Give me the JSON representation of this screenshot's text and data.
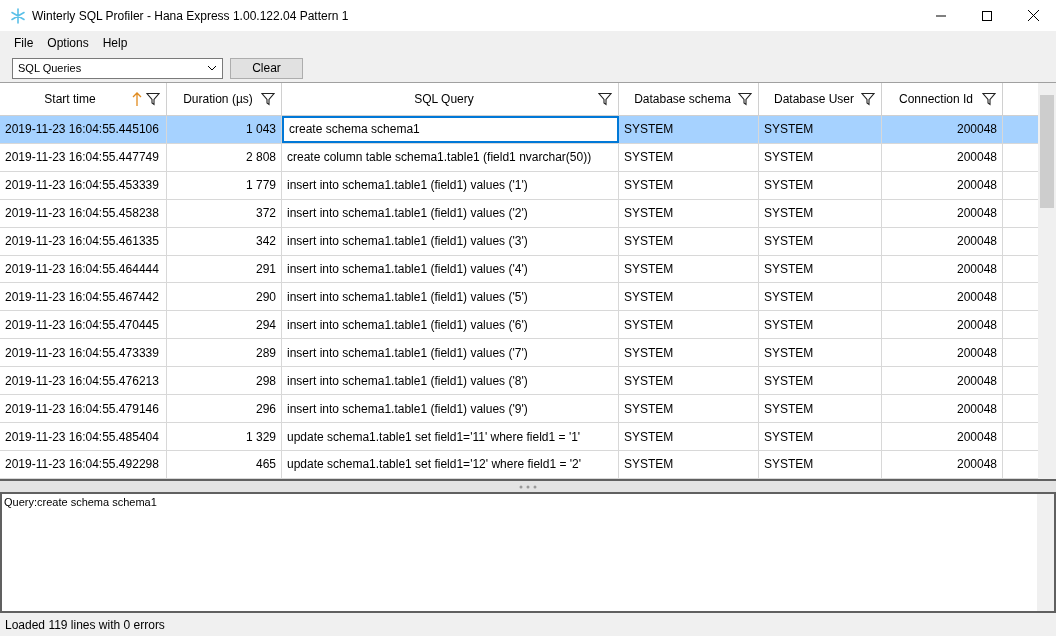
{
  "window": {
    "title": "Winterly SQL Profiler - Hana Express 1.00.122.04 Pattern 1"
  },
  "menu": [
    "File",
    "Options",
    "Help"
  ],
  "toolbar": {
    "dropdown": "SQL Queries",
    "button": "Clear"
  },
  "table": {
    "columns": [
      {
        "label": "Start time",
        "sorted": true,
        "kind": "text"
      },
      {
        "label": "Duration (µs)",
        "sorted": false,
        "kind": "number"
      },
      {
        "label": "SQL Query",
        "sorted": false,
        "kind": "query"
      },
      {
        "label": "Database schema",
        "sorted": false,
        "kind": "text"
      },
      {
        "label": "Database User",
        "sorted": false,
        "kind": "text"
      },
      {
        "label": "Connection Id",
        "sorted": false,
        "kind": "number"
      }
    ],
    "rows": [
      {
        "selected": true,
        "focused": true,
        "cells": [
          "2019-11-23 16:04:55.445106",
          "1 043",
          "create schema schema1",
          "SYSTEM",
          "SYSTEM",
          "200048"
        ]
      },
      {
        "selected": false,
        "focused": false,
        "cells": [
          "2019-11-23 16:04:55.447749",
          "2 808",
          "create column table schema1.table1 (field1 nvarchar(50))",
          "SYSTEM",
          "SYSTEM",
          "200048"
        ]
      },
      {
        "selected": false,
        "focused": false,
        "cells": [
          "2019-11-23 16:04:55.453339",
          "1 779",
          "insert into schema1.table1 (field1) values ('1')",
          "SYSTEM",
          "SYSTEM",
          "200048"
        ]
      },
      {
        "selected": false,
        "focused": false,
        "cells": [
          "2019-11-23 16:04:55.458238",
          "372",
          "insert into schema1.table1 (field1) values ('2')",
          "SYSTEM",
          "SYSTEM",
          "200048"
        ]
      },
      {
        "selected": false,
        "focused": false,
        "cells": [
          "2019-11-23 16:04:55.461335",
          "342",
          "insert into schema1.table1 (field1) values ('3')",
          "SYSTEM",
          "SYSTEM",
          "200048"
        ]
      },
      {
        "selected": false,
        "focused": false,
        "cells": [
          "2019-11-23 16:04:55.464444",
          "291",
          "insert into schema1.table1 (field1) values ('4')",
          "SYSTEM",
          "SYSTEM",
          "200048"
        ]
      },
      {
        "selected": false,
        "focused": false,
        "cells": [
          "2019-11-23 16:04:55.467442",
          "290",
          "insert into schema1.table1 (field1) values ('5')",
          "SYSTEM",
          "SYSTEM",
          "200048"
        ]
      },
      {
        "selected": false,
        "focused": false,
        "cells": [
          "2019-11-23 16:04:55.470445",
          "294",
          "insert into schema1.table1 (field1) values ('6')",
          "SYSTEM",
          "SYSTEM",
          "200048"
        ]
      },
      {
        "selected": false,
        "focused": false,
        "cells": [
          "2019-11-23 16:04:55.473339",
          "289",
          "insert into schema1.table1 (field1) values ('7')",
          "SYSTEM",
          "SYSTEM",
          "200048"
        ]
      },
      {
        "selected": false,
        "focused": false,
        "cells": [
          "2019-11-23 16:04:55.476213",
          "298",
          "insert into schema1.table1 (field1) values ('8')",
          "SYSTEM",
          "SYSTEM",
          "200048"
        ]
      },
      {
        "selected": false,
        "focused": false,
        "cells": [
          "2019-11-23 16:04:55.479146",
          "296",
          "insert into schema1.table1 (field1) values ('9')",
          "SYSTEM",
          "SYSTEM",
          "200048"
        ]
      },
      {
        "selected": false,
        "focused": false,
        "cells": [
          "2019-11-23 16:04:55.485404",
          "1 329",
          "update schema1.table1 set field1='11' where field1 = '1'",
          "SYSTEM",
          "SYSTEM",
          "200048"
        ]
      },
      {
        "selected": false,
        "focused": false,
        "cells": [
          "2019-11-23 16:04:55.492298",
          "465",
          "update schema1.table1 set field1='12' where field1 = '2'",
          "SYSTEM",
          "SYSTEM",
          "200048"
        ]
      }
    ]
  },
  "detail": "Query:create schema schema1",
  "status_bar": "Loaded 119 lines with 0 errors"
}
